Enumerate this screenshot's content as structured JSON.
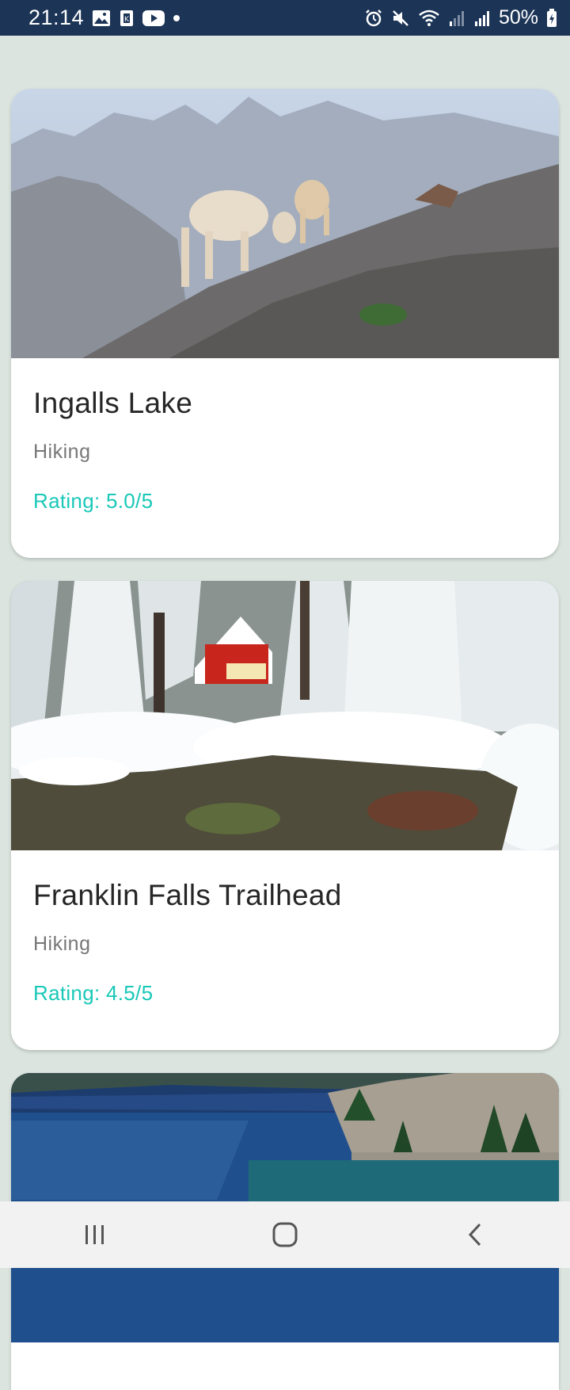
{
  "status_bar": {
    "time": "21:14",
    "battery": "50%",
    "left_icons": [
      "gallery-icon",
      "app-notification-icon",
      "youtube-icon",
      "more-notifications-dot"
    ],
    "right_icons": [
      "alarm-icon",
      "mute-icon",
      "wifi-icon",
      "signal-icon",
      "signal-icon",
      "battery-charging-icon"
    ]
  },
  "cards": [
    {
      "title": "Ingalls Lake",
      "category": "Hiking",
      "rating": "Rating: 5.0/5",
      "image": "mountain-goats-photo"
    },
    {
      "title": "Franklin Falls Trailhead",
      "category": "Hiking",
      "rating": "Rating: 4.5/5",
      "image": "snowy-cabin-creek-photo"
    },
    {
      "image": "alpine-lake-photo"
    }
  ],
  "nav_bar": {
    "buttons": [
      "recent-apps",
      "home",
      "back"
    ]
  },
  "colors": {
    "status_bar_bg": "#1c3557",
    "page_bg": "#dbe4df",
    "rating_accent": "#19c8b8"
  }
}
